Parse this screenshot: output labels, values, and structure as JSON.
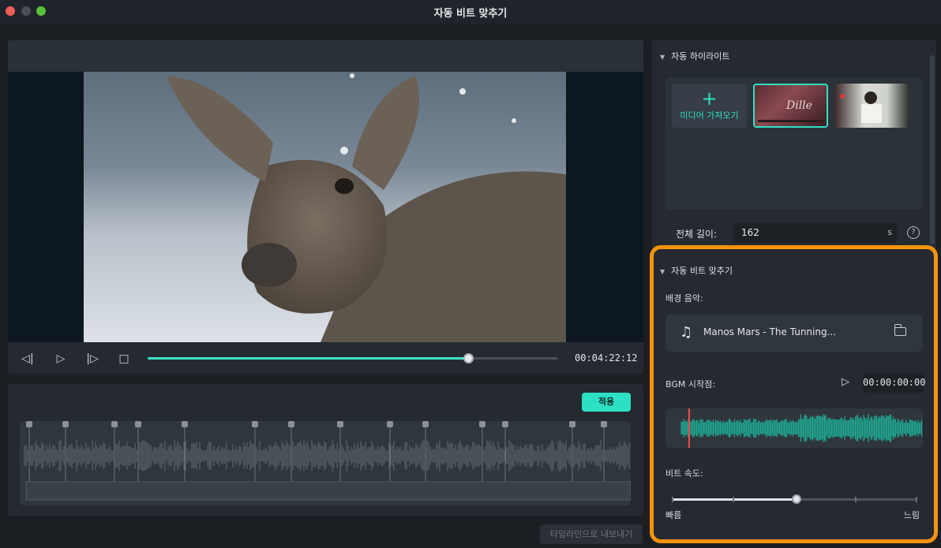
{
  "window": {
    "title": "자동 비트 맞추기"
  },
  "player": {
    "timecode": "00:04:22:12",
    "progress": 0.78
  },
  "beat_editor": {
    "apply_label": "적용",
    "export_label": "타임라인으로 내보내기"
  },
  "highlight": {
    "section_title": "자동 하이라이트",
    "import_label": "미디어 가져오기",
    "total_length_label": "전체 길이:",
    "total_length_value": "162",
    "total_length_unit": "s",
    "help_glyph": "?"
  },
  "autobeat": {
    "section_title": "자동 비트 맞추기",
    "bgm_label": "배경 음악:",
    "music_name": "Manos Mars - The Tunning...",
    "bgm_start_label": "BGM 시작점:",
    "bgm_start_time": "00:00:00:00",
    "speed_label": "비트 속도:",
    "speed_fast": "빠름",
    "speed_slow": "느림",
    "speed_level": 0.5
  },
  "colors": {
    "accent": "#2de0c3",
    "highlight_frame": "#f5930f"
  },
  "icons": [
    "prev-frame-icon",
    "play-icon",
    "next-frame-icon",
    "stop-icon",
    "plus-icon",
    "music-note-icon",
    "folder-icon",
    "help-icon"
  ]
}
